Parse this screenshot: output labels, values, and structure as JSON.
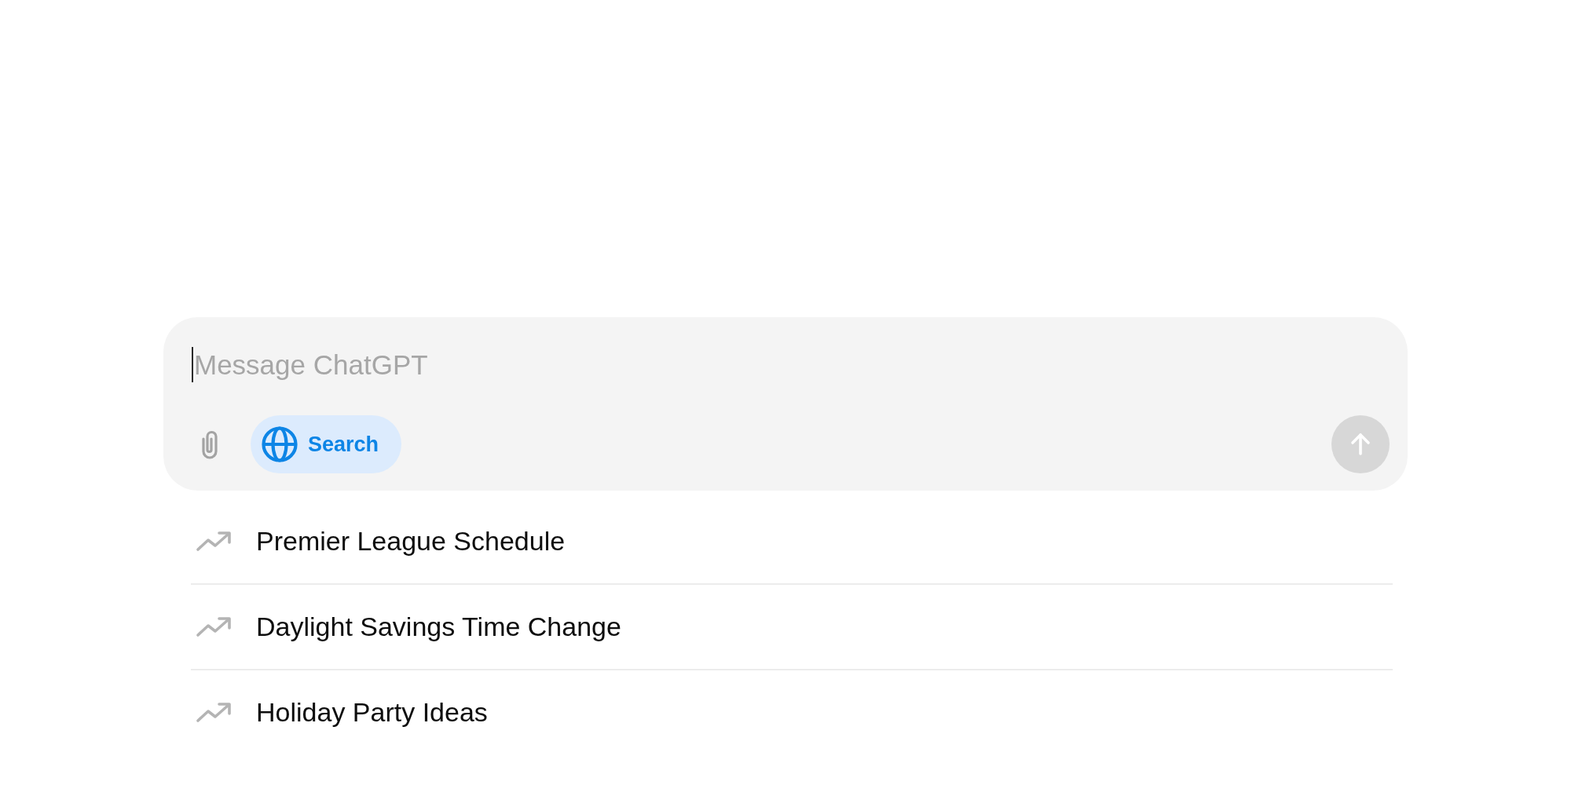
{
  "composer": {
    "message_field": {
      "placeholder": "Message ChatGPT",
      "focused": true
    },
    "search_toggle": {
      "label": "Search",
      "on": true
    },
    "send_button": {
      "disabled": true
    }
  },
  "suggestions": [
    {
      "label": "Premier League Schedule"
    },
    {
      "label": "Daylight Savings Time Change"
    },
    {
      "label": "Holiday Party Ideas"
    }
  ]
}
